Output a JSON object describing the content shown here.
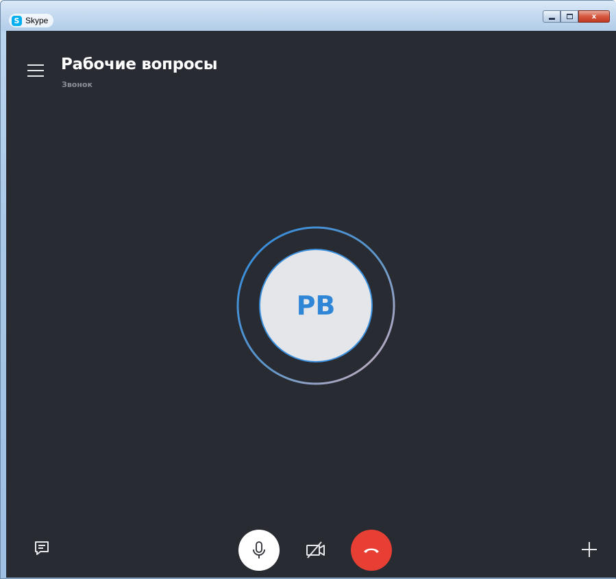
{
  "window": {
    "title": "Skype",
    "controls": [
      "minimize",
      "maximize",
      "close"
    ],
    "close_glyph": "x"
  },
  "call": {
    "conversation_title": "Рабочие вопросы",
    "status": "Звонок",
    "avatar_initials": "PB"
  },
  "icons": {
    "menu": "hamburger-icon",
    "chat": "chat-icon",
    "mic": "microphone-icon",
    "video": "video-off-icon",
    "hangup": "hang-up-icon",
    "add": "plus-icon"
  },
  "colors": {
    "background": "#292b32",
    "avatar_ring": "#3a8fdc",
    "initials": "#2f86d6",
    "hangup": "#e83f34"
  }
}
